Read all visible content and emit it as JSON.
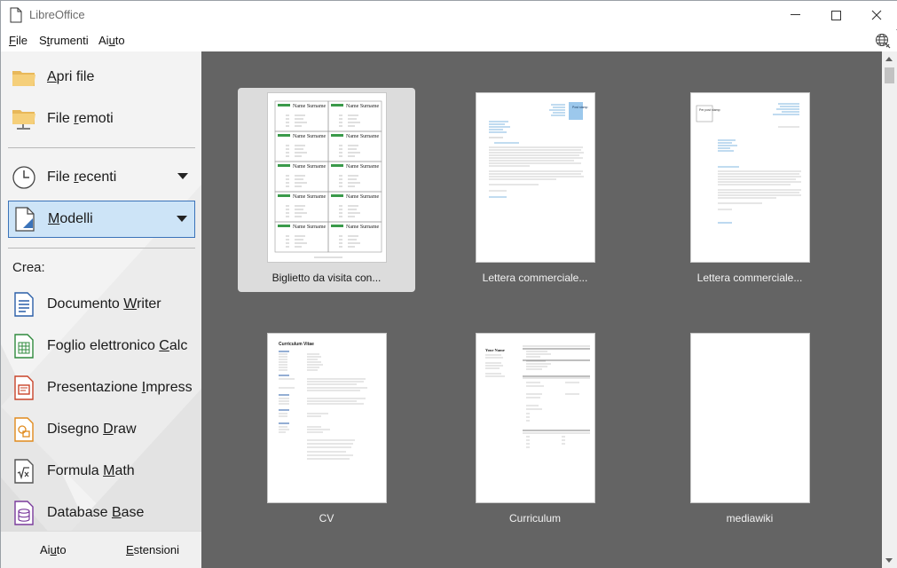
{
  "window": {
    "title": "LibreOffice"
  },
  "menubar": {
    "items": [
      {
        "pre": "",
        "ul": "F",
        "post": "ile"
      },
      {
        "pre": "S",
        "ul": "t",
        "post": "rumenti"
      },
      {
        "pre": "Ai",
        "ul": "u",
        "post": "to"
      }
    ]
  },
  "sidebar": {
    "open_file": {
      "pre": "",
      "ul": "A",
      "post": "pri file"
    },
    "remote_files": {
      "pre": "File ",
      "ul": "r",
      "post": "emoti"
    },
    "recent_files": {
      "pre": "File ",
      "ul": "r",
      "post": "ecenti"
    },
    "templates": {
      "pre": "",
      "ul": "M",
      "post": "odelli"
    },
    "create_label": "Crea:",
    "create_items": [
      {
        "pre": "Documento ",
        "ul": "W",
        "post": "riter",
        "color": "#2a5ea8"
      },
      {
        "pre": "Foglio elettronico ",
        "ul": "C",
        "post": "alc",
        "color": "#2f8a3d"
      },
      {
        "pre": "Presentazione ",
        "ul": "I",
        "post": "mpress",
        "color": "#c9442a"
      },
      {
        "pre": "Disegno ",
        "ul": "D",
        "post": "raw",
        "color": "#e08a1c"
      },
      {
        "pre": "Formula ",
        "ul": "M",
        "post": "ath",
        "color": "#555555"
      },
      {
        "pre": "Database ",
        "ul": "B",
        "post": "ase",
        "color": "#7a3b9c"
      }
    ],
    "footer": {
      "help": {
        "pre": "Ai",
        "ul": "u",
        "post": "to"
      },
      "extensions": {
        "pre": "",
        "ul": "E",
        "post": "stensioni"
      }
    }
  },
  "templates": [
    {
      "name": "Biglietto da visita con...",
      "selected": true
    },
    {
      "name": "Lettera commerciale...",
      "selected": false
    },
    {
      "name": "Lettera commerciale...",
      "selected": false
    },
    {
      "name": "CV",
      "selected": false
    },
    {
      "name": "Curriculum",
      "selected": false
    },
    {
      "name": "mediawiki",
      "selected": false
    }
  ],
  "thumb_text": {
    "card_name": "Name Surname",
    "cv_title": "Curriculum Vitae",
    "resume_name": "Your Name",
    "stamp": "Post stamp",
    "letter_stamp": "Per post stamp"
  },
  "colors": {
    "main_bg": "#646464",
    "selection": "#cde4f7",
    "selection_border": "#3b73b9"
  }
}
